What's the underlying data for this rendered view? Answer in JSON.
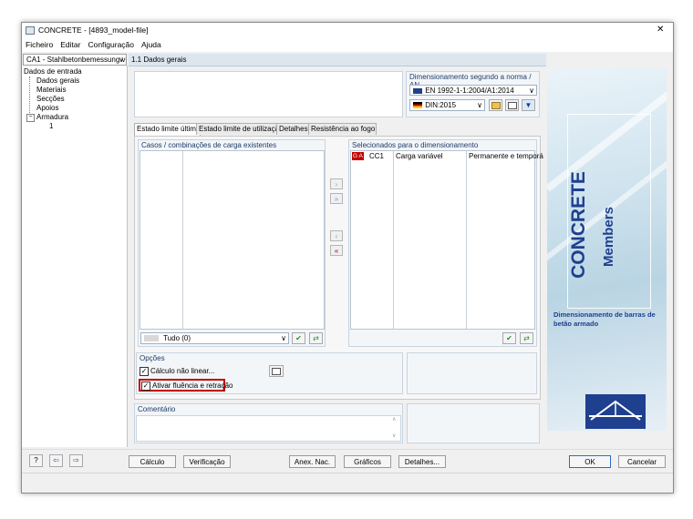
{
  "window": {
    "title": "CONCRETE - [4893_model-file]",
    "close_glyph": "✕"
  },
  "menu": [
    "Ficheiro",
    "Editar",
    "Configuração",
    "Ajuda"
  ],
  "case_selector": "CA1 - Stahlbetonbemessung vo",
  "tree": {
    "root": "Dados de entrada",
    "items": [
      "Dados gerais",
      "Materiais",
      "Secções",
      "Apoios",
      "Armadura",
      "1"
    ]
  },
  "panel_title": "1.1 Dados gerais",
  "design": {
    "label": "Dimensionamento segundo a norma / AN",
    "norm": "EN 1992-1-1:2004/A1:2014",
    "annex": "DIN:2015"
  },
  "tabs": [
    "Estado limite último",
    "Estado limite de utilização",
    "Detalhes",
    "Resistência ao fogo"
  ],
  "left_list": {
    "label": "Casos / combinações de carga existentes",
    "filter": "Tudo (0)"
  },
  "right_list": {
    "label": "Selecionados para o dimensionamento",
    "rows": [
      {
        "badge": "G A",
        "id": "CC1",
        "desc": "Carga variável",
        "type": "Permanente e temporá"
      }
    ]
  },
  "options": {
    "label": "Opções",
    "nonlinear": "Cálculo não linear...",
    "creep": "Ativar fluência e retração"
  },
  "comment": {
    "label": "Comentário",
    "value": ""
  },
  "logo": {
    "main": "CONCRETE",
    "sub": "Members",
    "caption": "Dimensionamento de barras de betão armado"
  },
  "bottom_buttons": {
    "calc": "Cálculo",
    "check": "Verificação",
    "annex": "Anex. Nac.",
    "graphics": "Gráficos",
    "details": "Detalhes...",
    "ok": "OK",
    "cancel": "Cancelar"
  },
  "colors": {
    "accent_red": "#c00000",
    "brand_blue": "#1f3f8f",
    "header_blue": "#dde6ef"
  }
}
